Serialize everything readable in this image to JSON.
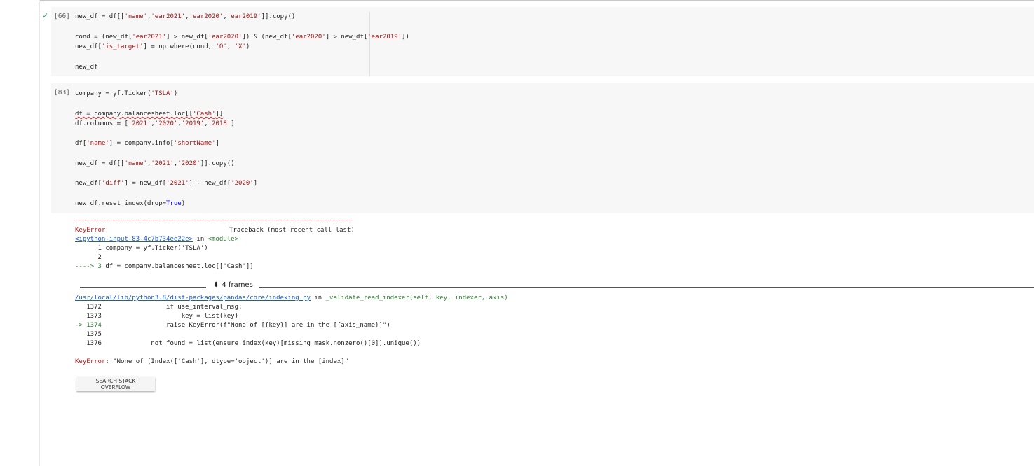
{
  "cell66": {
    "exec_count": "[66]",
    "line1_a": "new_df = df[[",
    "line1_s1": "'name'",
    "line1_b": ",",
    "line1_s2": "'ear2021'",
    "line1_c": ",",
    "line1_s3": "'ear2020'",
    "line1_d": ",",
    "line1_s4": "'ear2019'",
    "line1_e": "]].copy()",
    "line2_a": "cond = (new_df[",
    "line2_s1": "'ear2021'",
    "line2_b": "] > new_df[",
    "line2_s2": "'ear2020'",
    "line2_c": "]) & (new_df[",
    "line2_s3": "'ear2020'",
    "line2_d": "] > new_df[",
    "line2_s4": "'ear2019'",
    "line2_e": "])",
    "line3_a": "new_df[",
    "line3_s1": "'is_target'",
    "line3_b": "] = np.where(cond, ",
    "line3_s2": "'O'",
    "line3_c": ", ",
    "line3_s3": "'X'",
    "line3_d": ")",
    "line4": "new_df"
  },
  "cell83": {
    "exec_count": "[83]",
    "l1_a": "company = yf.Ticker(",
    "l1_s": "'TSLA'",
    "l1_b": ")",
    "l2_a": "df = company.balancesheet.loc[[",
    "l2_s": "'Cash'",
    "l2_b": "]]",
    "l3_a": "df.columns = [",
    "l3_s1": "'2021'",
    "l3_b": ",",
    "l3_s2": "'2020'",
    "l3_c": ",",
    "l3_s3": "'2019'",
    "l3_d": ",",
    "l3_s4": "'2018'",
    "l3_e": "]",
    "l4_a": "df[",
    "l4_s1": "'name'",
    "l4_b": "] = company.info[",
    "l4_s2": "'shortName'",
    "l4_c": "]",
    "l5_a": "new_df = df[[",
    "l5_s1": "'name'",
    "l5_b": ",",
    "l5_s2": "'2021'",
    "l5_c": ",",
    "l5_s3": "'2020'",
    "l5_d": "]].copy()",
    "l6_a": "new_df[",
    "l6_s1": "'diff'",
    "l6_b": "] = new_df[",
    "l6_s2": "'2021'",
    "l6_c": "] - new_df[",
    "l6_s3": "'2020'",
    "l6_d": "]",
    "l7_a": "new_df.reset_index(drop=",
    "l7_kw": "True",
    "l7_b": ")"
  },
  "output": {
    "error_name": "KeyError",
    "traceback_header": "Traceback (most recent call last)",
    "frame1_link": "<ipython-input-83-4c7b734ee22e>",
    "frame1_in": " in ",
    "frame1_module": "<module>",
    "frame1_l1": "      1 company = yf.Ticker('TSLA')",
    "frame1_l2": "      2 ",
    "frame1_arrow": "----> 3",
    "frame1_l3": " df = company.balancesheet.loc[['Cash']]",
    "frames_label": "4 frames",
    "frame2_link": "/usr/local/lib/python3.8/dist-packages/pandas/core/indexing.py",
    "frame2_in": " in ",
    "frame2_func": "_validate_read_indexer(self, key, indexer, axis)",
    "frame2_l1": "   1372                 if use_interval_msg:",
    "frame2_l2": "   1373                     key = list(key)",
    "frame2_arrow": "-> 1374",
    "frame2_l3": "                 raise KeyError(f\"None of [{key}] are in the [{axis_name}]\")",
    "frame2_l4": "   1375 ",
    "frame2_l5": "   1376             not_found = list(ensure_index(key)[missing_mask.nonzero()[0]].unique())",
    "final_error_name": "KeyError",
    "final_error_msg": ": \"None of [Index(['Cash'], dtype='object')] are in the [index]\"",
    "so_button": "SEARCH STACK OVERFLOW"
  }
}
